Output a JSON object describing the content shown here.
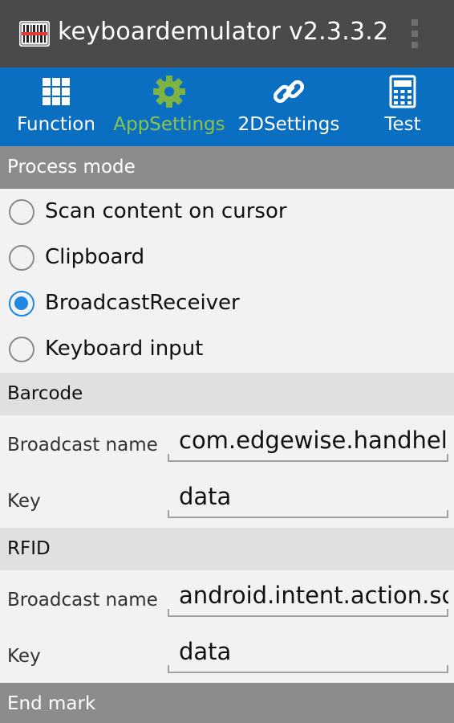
{
  "app": {
    "title": "keyboardemulator v2.3.3.2",
    "icon": "barcode-scanner-icon"
  },
  "tabs": [
    {
      "label": "Function",
      "icon": "grid-icon",
      "active": false
    },
    {
      "label": "AppSettings",
      "icon": "gear-icon",
      "active": true
    },
    {
      "label": "2DSettings",
      "icon": "link-icon",
      "active": false
    },
    {
      "label": "Test",
      "icon": "calculator-icon",
      "active": false
    }
  ],
  "process_mode": {
    "header": "Process mode",
    "options": [
      {
        "label": "Scan content on cursor",
        "checked": false
      },
      {
        "label": "Clipboard",
        "checked": false
      },
      {
        "label": "BroadcastReceiver",
        "checked": true
      },
      {
        "label": "Keyboard input",
        "checked": false
      }
    ]
  },
  "barcode": {
    "header": "Barcode",
    "broadcast_label": "Broadcast name",
    "broadcast_value": "com.edgewise.handhel",
    "key_label": "Key",
    "key_value": "data"
  },
  "rfid": {
    "header": "RFID",
    "broadcast_label": "Broadcast name",
    "broadcast_value": "android.intent.action.sc",
    "key_label": "Key",
    "key_value": "data"
  },
  "end_mark": {
    "header": "End mark"
  },
  "colors": {
    "titlebar": "#4a4a4a",
    "tabbar": "#0b6fc1",
    "active_tab": "#8bc34a",
    "radio_checked": "#1e88e5"
  }
}
